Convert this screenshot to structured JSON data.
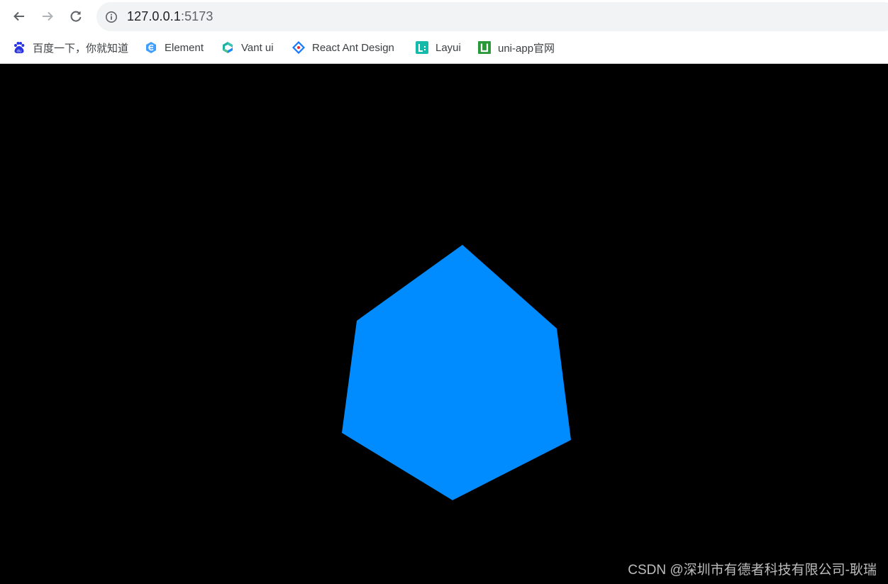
{
  "browser": {
    "url_host": "127.0.0.1",
    "url_port": ":5173",
    "bookmarks": [
      {
        "label": "百度一下，你就知道",
        "icon": "baidu-icon"
      },
      {
        "label": "Element",
        "icon": "element-icon"
      },
      {
        "label": "Vant ui",
        "icon": "vant-icon"
      },
      {
        "label": "React Ant Design",
        "icon": "antd-icon"
      },
      {
        "label": "Layui",
        "icon": "layui-icon"
      },
      {
        "label": "uni-app官网",
        "icon": "uniapp-icon"
      }
    ]
  },
  "scene": {
    "background_color": "#000000",
    "cube_color": "#008cff"
  },
  "watermark": "CSDN @深圳市有德者科技有限公司-耿瑞"
}
